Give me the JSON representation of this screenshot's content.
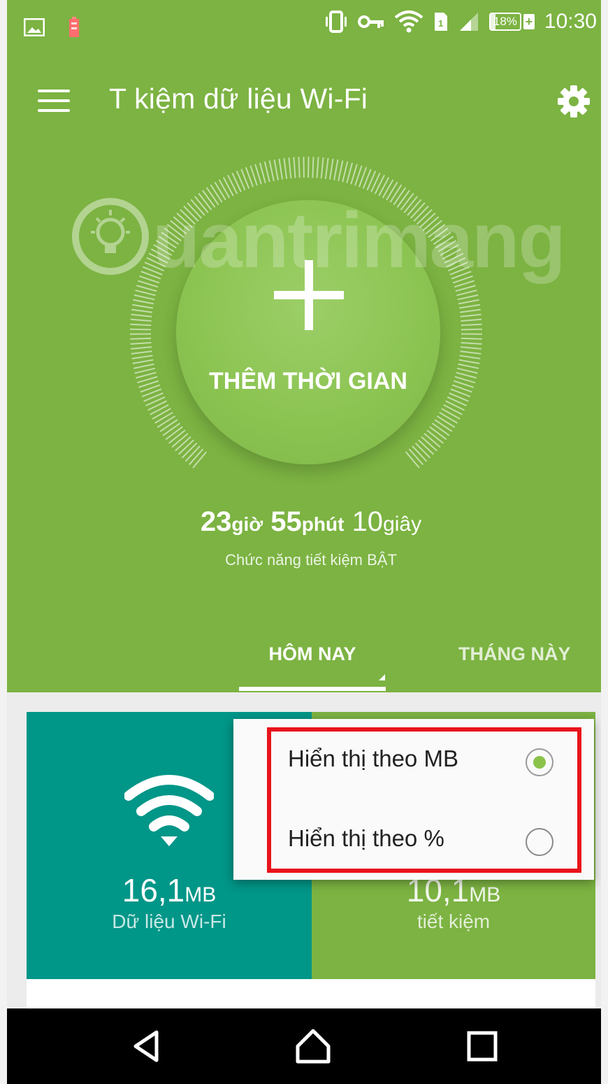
{
  "status_bar": {
    "icons": [
      "image-icon",
      "battery-warning-icon",
      "vibrate-icon",
      "vpn-key-icon",
      "wifi-icon",
      "sim-icon",
      "signal-icon"
    ],
    "battery_percent": "18%",
    "time": "10:30"
  },
  "header": {
    "title": "T kiệm dữ liệu Wi-Fi",
    "menu_icon": "menu-icon",
    "settings_icon": "gear-icon"
  },
  "watermark": {
    "text": "uantrimang"
  },
  "add_time_button": {
    "label": "THÊM THỜI GIAN"
  },
  "timer": {
    "hours": "23",
    "hours_unit": "giờ",
    "minutes": "55",
    "minutes_unit": "phút",
    "seconds": "10",
    "seconds_unit": "giây",
    "status": "Chức năng tiết kiệm BẬT"
  },
  "tabs": [
    {
      "label": "HÔM NAY",
      "selected": true
    },
    {
      "label": "THÁNG NÀY",
      "selected": false
    }
  ],
  "cards": {
    "wifi": {
      "value": "16,1",
      "unit": "MB",
      "label": "Dữ liệu Wi-Fi",
      "color": "#009688"
    },
    "saved": {
      "value": "10,1",
      "unit": "MB",
      "label": "tiết kiệm",
      "color": "#7cb342"
    }
  },
  "popup_menu": {
    "options": [
      {
        "label": "Hiển thị theo MB",
        "selected": true
      },
      {
        "label": "Hiển thị theo %",
        "selected": false
      }
    ],
    "highlight_color": "#e8131b"
  },
  "nav_bar": {
    "buttons": [
      "back-icon",
      "home-icon",
      "recents-icon"
    ]
  },
  "colors": {
    "primary": "#7cb342",
    "accent": "#8bc34a",
    "teal": "#009688"
  }
}
